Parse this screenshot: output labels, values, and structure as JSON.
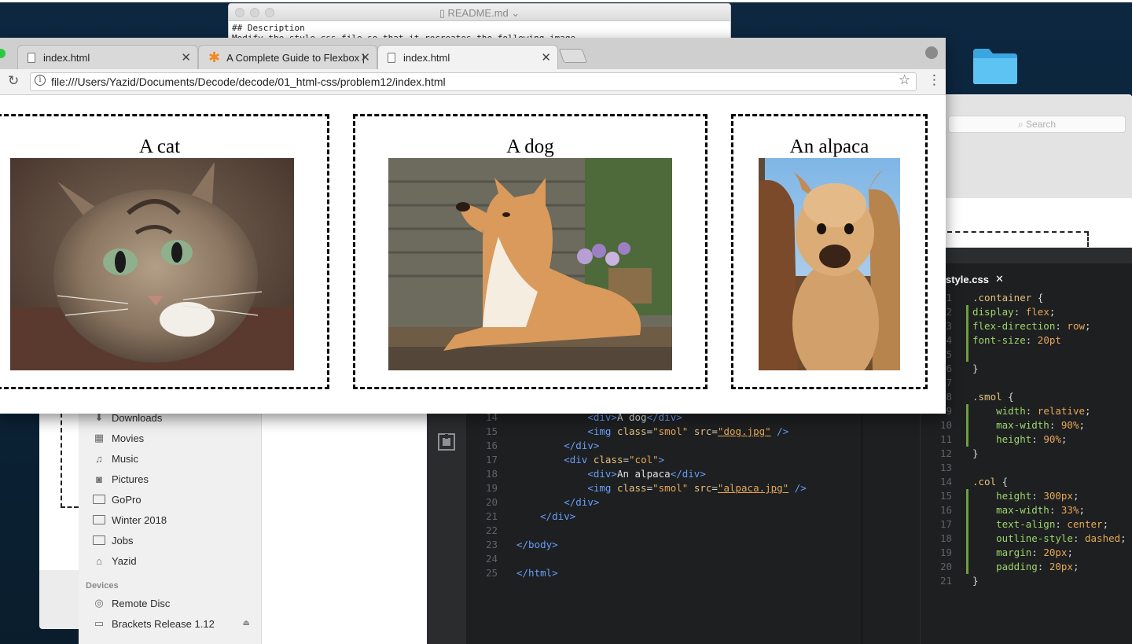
{
  "readme": {
    "title": "README.md",
    "line1": "## Description",
    "line2": "Modify the style.css file so that it recreates the following image"
  },
  "finder": {
    "search_placeholder": "Search",
    "sidebar": {
      "items": [
        {
          "label": "Downloads",
          "icon": "downloads-icon"
        },
        {
          "label": "Movies",
          "icon": "movies-icon"
        },
        {
          "label": "Music",
          "icon": "music-icon"
        },
        {
          "label": "Pictures",
          "icon": "pictures-icon"
        },
        {
          "label": "GoPro",
          "icon": "folder-icon"
        },
        {
          "label": "Winter 2018",
          "icon": "folder-icon"
        },
        {
          "label": "Jobs",
          "icon": "folder-icon"
        },
        {
          "label": "Yazid",
          "icon": "home-icon"
        }
      ],
      "devices_header": "Devices",
      "devices": [
        {
          "label": "Remote Disc",
          "icon": "disc-icon"
        },
        {
          "label": "Brackets Release 1.12",
          "icon": "drive-icon",
          "eject": "⏏"
        }
      ]
    }
  },
  "browser": {
    "tabs": [
      {
        "label": "index.html",
        "active": false
      },
      {
        "label": "A Complete Guide to Flexbox |",
        "active": false
      },
      {
        "label": "index.html",
        "active": true
      }
    ],
    "url": "file:///Users/Yazid/Documents/Decode/decode/01_html-css/problem12/index.html",
    "page": {
      "columns": [
        {
          "title": "A cat",
          "image": "cat-photo"
        },
        {
          "title": "A dog",
          "image": "dog-photo"
        },
        {
          "title": "An alpaca",
          "image": "alpaca-photo"
        }
      ]
    }
  },
  "editor": {
    "css_tab_label": "style.css",
    "html_lines": [
      {
        "n": "14",
        "pre": "            ",
        "parts": [
          [
            "t-tag",
            "<div>"
          ],
          [
            "t-txt",
            "A dog"
          ],
          [
            "t-tag",
            "</div>"
          ]
        ]
      },
      {
        "n": "15",
        "pre": "            ",
        "parts": [
          [
            "t-tag",
            "<img "
          ],
          [
            "t-attr",
            "class"
          ],
          [
            "t-punc",
            "="
          ],
          [
            "t-str",
            "\"smol\""
          ],
          [
            "t-txt",
            " "
          ],
          [
            "t-attr",
            "src"
          ],
          [
            "t-punc",
            "="
          ],
          [
            "t-str",
            "\"dog.jpg\""
          ],
          [
            "t-tag",
            " />"
          ]
        ]
      },
      {
        "n": "16",
        "pre": "        ",
        "parts": [
          [
            "t-tag",
            "</div>"
          ]
        ]
      },
      {
        "n": "17",
        "pre": "        ",
        "parts": [
          [
            "t-tag",
            "<div "
          ],
          [
            "t-attr",
            "class"
          ],
          [
            "t-punc",
            "="
          ],
          [
            "t-str",
            "\"col\""
          ],
          [
            "t-tag",
            ">"
          ]
        ]
      },
      {
        "n": "18",
        "pre": "            ",
        "parts": [
          [
            "t-tag",
            "<div>"
          ],
          [
            "t-txt",
            "An alpaca"
          ],
          [
            "t-tag",
            "</div>"
          ]
        ]
      },
      {
        "n": "19",
        "pre": "            ",
        "parts": [
          [
            "t-tag",
            "<img "
          ],
          [
            "t-attr",
            "class"
          ],
          [
            "t-punc",
            "="
          ],
          [
            "t-str",
            "\"smol\""
          ],
          [
            "t-txt",
            " "
          ],
          [
            "t-attr",
            "src"
          ],
          [
            "t-punc",
            "="
          ],
          [
            "t-str",
            "\"alpaca.jpg\""
          ],
          [
            "t-tag",
            " />"
          ]
        ]
      },
      {
        "n": "20",
        "pre": "        ",
        "parts": [
          [
            "t-tag",
            "</div>"
          ]
        ]
      },
      {
        "n": "21",
        "pre": "    ",
        "parts": [
          [
            "t-tag",
            "</div>"
          ]
        ]
      },
      {
        "n": "22",
        "pre": "",
        "parts": []
      },
      {
        "n": "23",
        "pre": "",
        "parts": [
          [
            "t-tag",
            "</body>"
          ]
        ]
      },
      {
        "n": "24",
        "pre": "",
        "parts": []
      },
      {
        "n": "25",
        "pre": "",
        "parts": [
          [
            "t-tag",
            "</html>"
          ]
        ]
      }
    ],
    "css_lines": [
      {
        "n": "1",
        "mark": false,
        "parts": [
          [
            "t-sel",
            ".container"
          ],
          [
            "t-punc",
            " {"
          ]
        ]
      },
      {
        "n": "2",
        "mark": true,
        "parts": [
          [
            "t-prop",
            "display"
          ],
          [
            "t-punc",
            ": "
          ],
          [
            "t-val",
            "flex"
          ],
          [
            "t-punc",
            ";"
          ]
        ]
      },
      {
        "n": "3",
        "mark": true,
        "parts": [
          [
            "t-prop",
            "flex-direction"
          ],
          [
            "t-punc",
            ": "
          ],
          [
            "t-val",
            "row"
          ],
          [
            "t-punc",
            ";"
          ]
        ]
      },
      {
        "n": "4",
        "mark": true,
        "parts": [
          [
            "t-prop",
            "font-size"
          ],
          [
            "t-punc",
            ": "
          ],
          [
            "t-val",
            "20pt"
          ]
        ]
      },
      {
        "n": "5",
        "mark": true,
        "parts": []
      },
      {
        "n": "6",
        "mark": false,
        "parts": [
          [
            "t-punc",
            "}"
          ]
        ]
      },
      {
        "n": "7",
        "mark": false,
        "parts": []
      },
      {
        "n": "8",
        "mark": false,
        "parts": [
          [
            "t-sel",
            ".smol"
          ],
          [
            "t-punc",
            " {"
          ]
        ]
      },
      {
        "n": "9",
        "mark": true,
        "parts": [
          [
            "t-prop",
            "    width"
          ],
          [
            "t-punc",
            ": "
          ],
          [
            "t-val",
            "relative"
          ],
          [
            "t-punc",
            ";"
          ]
        ]
      },
      {
        "n": "10",
        "mark": true,
        "parts": [
          [
            "t-prop",
            "    max-width"
          ],
          [
            "t-punc",
            ": "
          ],
          [
            "t-val",
            "90%"
          ],
          [
            "t-punc",
            ";"
          ]
        ]
      },
      {
        "n": "11",
        "mark": true,
        "parts": [
          [
            "t-prop",
            "    height"
          ],
          [
            "t-punc",
            ": "
          ],
          [
            "t-val",
            "90%"
          ],
          [
            "t-punc",
            ";"
          ]
        ]
      },
      {
        "n": "12",
        "mark": false,
        "parts": [
          [
            "t-punc",
            "}"
          ]
        ]
      },
      {
        "n": "13",
        "mark": false,
        "parts": []
      },
      {
        "n": "14",
        "mark": false,
        "parts": [
          [
            "t-sel",
            ".col"
          ],
          [
            "t-punc",
            " {"
          ]
        ]
      },
      {
        "n": "15",
        "mark": true,
        "parts": [
          [
            "t-prop",
            "    height"
          ],
          [
            "t-punc",
            ": "
          ],
          [
            "t-val",
            "300px"
          ],
          [
            "t-punc",
            ";"
          ]
        ]
      },
      {
        "n": "16",
        "mark": true,
        "parts": [
          [
            "t-prop",
            "    max-width"
          ],
          [
            "t-punc",
            ": "
          ],
          [
            "t-val",
            "33%"
          ],
          [
            "t-punc",
            ";"
          ]
        ]
      },
      {
        "n": "17",
        "mark": true,
        "parts": [
          [
            "t-prop",
            "    text-align"
          ],
          [
            "t-punc",
            ": "
          ],
          [
            "t-val",
            "center"
          ],
          [
            "t-punc",
            ";"
          ]
        ]
      },
      {
        "n": "18",
        "mark": true,
        "parts": [
          [
            "t-prop",
            "    outline-style"
          ],
          [
            "t-punc",
            ": "
          ],
          [
            "t-val",
            "dashed"
          ],
          [
            "t-punc",
            ";"
          ]
        ]
      },
      {
        "n": "19",
        "mark": true,
        "parts": [
          [
            "t-prop",
            "    margin"
          ],
          [
            "t-punc",
            ": "
          ],
          [
            "t-val",
            "20px"
          ],
          [
            "t-punc",
            ";"
          ]
        ]
      },
      {
        "n": "20",
        "mark": true,
        "parts": [
          [
            "t-prop",
            "    padding"
          ],
          [
            "t-punc",
            ": "
          ],
          [
            "t-val",
            "20px"
          ],
          [
            "t-punc",
            ";"
          ]
        ]
      },
      {
        "n": "21",
        "mark": false,
        "parts": [
          [
            "t-punc",
            "}"
          ]
        ]
      }
    ]
  }
}
